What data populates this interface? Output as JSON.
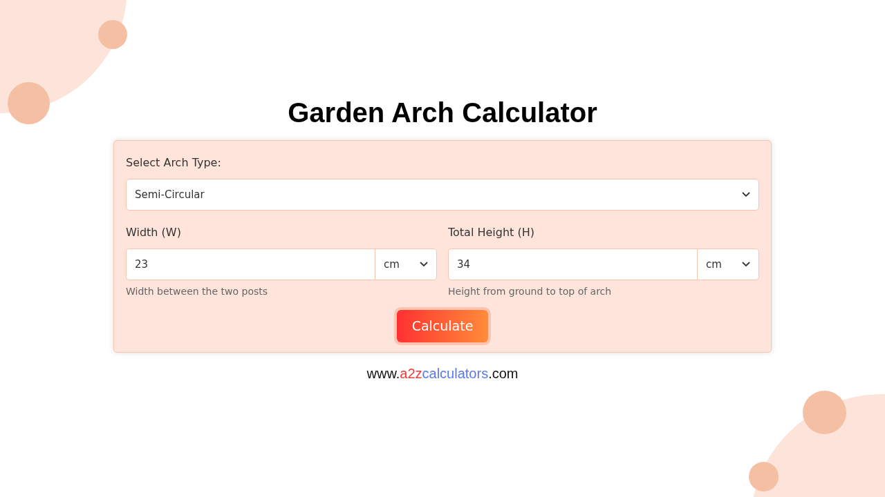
{
  "title": "Garden Arch Calculator",
  "form": {
    "arch_type": {
      "label": "Select Arch Type:",
      "value": "Semi-Circular"
    },
    "fields": [
      {
        "label": "Width (W)",
        "value": "23",
        "unit": "cm",
        "hint": "Width between the two posts"
      },
      {
        "label": "Total Height (H)",
        "value": "34",
        "unit": "cm",
        "hint": "Height from ground to top of arch"
      }
    ],
    "button": "Calculate"
  },
  "footer": [
    {
      "text": "www.",
      "color": "#111111"
    },
    {
      "text": "a2z",
      "color": "#ef3b36"
    },
    {
      "text": "calculators",
      "color": "#5a78f0"
    },
    {
      "text": ".com",
      "color": "#111111"
    }
  ]
}
